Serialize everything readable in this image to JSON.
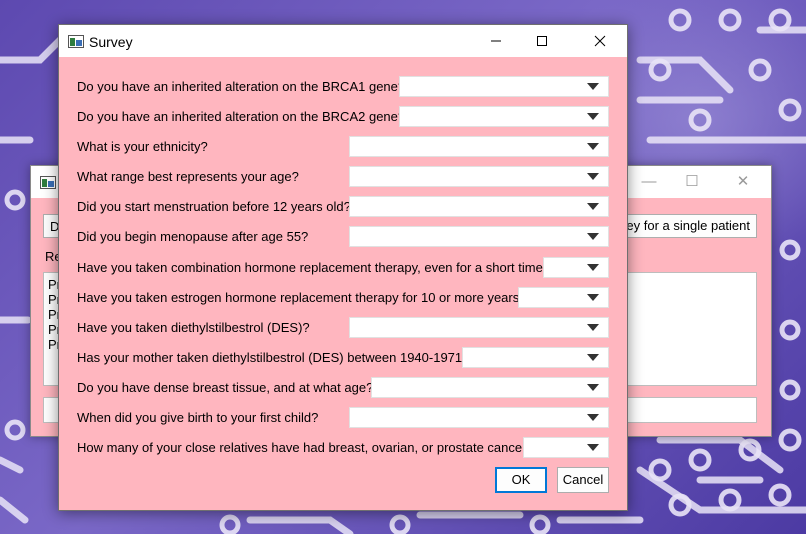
{
  "dialog": {
    "title": "Survey",
    "ok_label": "OK",
    "cancel_label": "Cancel",
    "questions": [
      {
        "label": "Do you have an inherited alteration on the BRCA1 gene?",
        "value": ""
      },
      {
        "label": "Do you have an inherited alteration on the BRCA2 gene?",
        "value": ""
      },
      {
        "label": "What is your ethnicity?",
        "value": ""
      },
      {
        "label": "What range best represents your age?",
        "value": ""
      },
      {
        "label": "Did you start menstruation before 12 years old?",
        "value": ""
      },
      {
        "label": "Did you begin menopause after age 55?",
        "value": ""
      },
      {
        "label": "Have you taken combination hormone replacement therapy, even for a short time?",
        "value": ""
      },
      {
        "label": "Have you taken estrogen hormone replacement therapy for 10 or more years?",
        "value": ""
      },
      {
        "label": "Have you taken diethylstilbestrol (DES)?",
        "value": ""
      },
      {
        "label": "Has your mother taken diethylstilbestrol (DES) between 1940-1971?",
        "value": ""
      },
      {
        "label": "Do you have dense breast tissue, and at what age?",
        "value": ""
      },
      {
        "label": "When did you give birth to your first child?",
        "value": ""
      },
      {
        "label": "How many of your close relatives have had breast, ovarian, or prostate cancer?",
        "value": ""
      }
    ]
  },
  "background_window": {
    "left_button_label": "D",
    "right_button_label": "vey for a single patient",
    "label": "Re",
    "text_lines": [
      "Pr",
      "Pr",
      "Pr",
      "Pr",
      "Pr"
    ]
  },
  "colors": {
    "dialog_background": "#ffb6bf",
    "titlebar": "#ffffff",
    "ok_focus_border": "#0078d7"
  },
  "icons": [
    "app-icon",
    "minimize-icon",
    "maximize-icon",
    "close-icon",
    "dropdown-arrow-icon"
  ]
}
